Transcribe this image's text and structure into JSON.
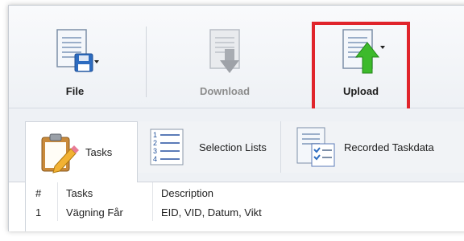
{
  "toolbar": {
    "file_label": "File",
    "download_label": "Download",
    "upload_label": "Upload"
  },
  "tabs": [
    {
      "label": "Tasks",
      "icon": "clipboard-pencil-icon",
      "active": true
    },
    {
      "label": "Selection Lists",
      "icon": "numbered-list-icon",
      "active": false
    },
    {
      "label": "Recorded Taskdata",
      "icon": "checklist-document-icon",
      "active": false
    }
  ],
  "table": {
    "headers": [
      "#",
      "Tasks",
      "Description"
    ],
    "rows": [
      [
        "1",
        "Vägning Får",
        "EID, VID, Datum, Vikt"
      ]
    ]
  },
  "colors": {
    "highlight_border": "#e0242b",
    "upload_arrow": "#3dba2b",
    "disk_blue": "#2d6cc0"
  }
}
